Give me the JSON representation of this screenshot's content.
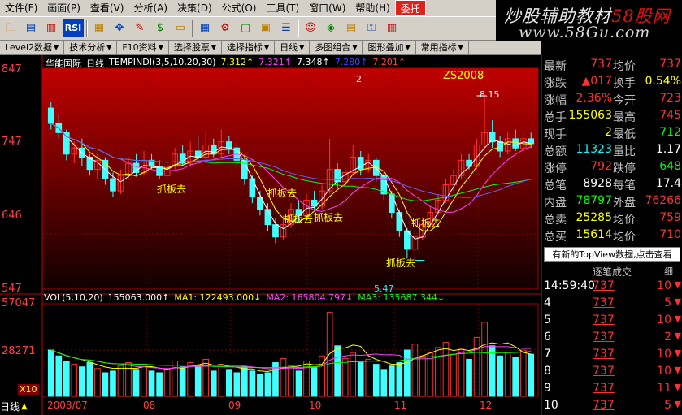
{
  "menu": [
    "文件(F)",
    "画面(P)",
    "查看(V)",
    "分析(A)",
    "决策(D)",
    "公式(O)",
    "工具(T)",
    "窗口(W)",
    "帮助(H)",
    "委托"
  ],
  "toolbar_icons": [
    "folder-icon",
    "chart-icon",
    "kline-icon",
    "rsi-button",
    "f10-icon",
    "move-icon",
    "pen-icon",
    "dollar-icon",
    "ruler-icon",
    "grid-icon",
    "tools-icon",
    "blank-icon",
    "save-icon",
    "list-icon",
    "person-icon",
    "map-icon",
    "news-icon",
    "lock-icon",
    "book-icon"
  ],
  "toolbar_rsi_label": "RSI",
  "brand": {
    "line1_a": "炒股辅助教材",
    "line1_b": "58股网",
    "line2": "www.58Gu.com"
  },
  "tabs": [
    "Level2数据",
    "技术分析",
    "F10资料",
    "选择股票",
    "选择指标",
    "日线",
    "多图组合",
    "图形叠加",
    "常用指标"
  ],
  "chart_header": {
    "stock_name": "华能国际",
    "period": "日线",
    "indicator": "TEMPINDI(3,5,10,20,30)",
    "values": [
      "7.312↑",
      "7.321↑",
      "7.348↑",
      "7.280↑",
      "7.201↑"
    ]
  },
  "vol_header": {
    "label": "VOL(5,10,20)",
    "items": [
      "155063.000↑",
      "MA1: 122493.000↓",
      "MA2: 165804.797↓",
      "MA3: 135687.344↓"
    ]
  },
  "y_axis_labels": [
    "847",
    "747",
    "646",
    "547"
  ],
  "vol_axis_labels": [
    "57047",
    "28271"
  ],
  "x10_label": "X10",
  "x_axis_labels": [
    "2008/07",
    "08",
    "09",
    "10",
    "11",
    "12"
  ],
  "day_button": "日线",
  "annotations": {
    "zs": "ZS2008",
    "high": "8.15",
    "low": "5.47",
    "marker_2": "2",
    "grab": [
      "抓板去",
      "抓板去",
      "抓板去",
      "抓板去",
      "抓板去",
      "抓板去"
    ]
  },
  "chart_data": {
    "type": "candlestick",
    "ylim": [
      5.0,
      8.6
    ],
    "candles": [
      {
        "o": 7.95,
        "c": 7.7,
        "h": 8.05,
        "l": 7.6
      },
      {
        "o": 7.7,
        "c": 7.55,
        "h": 7.85,
        "l": 7.45
      },
      {
        "o": 7.55,
        "c": 7.2,
        "h": 7.6,
        "l": 7.1
      },
      {
        "o": 7.2,
        "c": 7.3,
        "h": 7.4,
        "l": 7.05
      },
      {
        "o": 7.3,
        "c": 7.15,
        "h": 7.45,
        "l": 7.0
      },
      {
        "o": 7.15,
        "c": 6.95,
        "h": 7.2,
        "l": 6.85
      },
      {
        "o": 6.95,
        "c": 7.1,
        "h": 7.2,
        "l": 6.8
      },
      {
        "o": 7.1,
        "c": 6.8,
        "h": 7.15,
        "l": 6.7
      },
      {
        "o": 6.8,
        "c": 6.6,
        "h": 6.9,
        "l": 6.5
      },
      {
        "o": 6.6,
        "c": 6.85,
        "h": 6.95,
        "l": 6.55
      },
      {
        "o": 6.85,
        "c": 7.05,
        "h": 7.15,
        "l": 6.8
      },
      {
        "o": 7.05,
        "c": 6.9,
        "h": 7.2,
        "l": 6.85
      },
      {
        "o": 6.9,
        "c": 7.1,
        "h": 7.25,
        "l": 6.85
      },
      {
        "o": 7.1,
        "c": 7.0,
        "h": 7.2,
        "l": 6.95
      },
      {
        "o": 7.0,
        "c": 6.85,
        "h": 7.1,
        "l": 6.8
      },
      {
        "o": 6.85,
        "c": 7.0,
        "h": 7.1,
        "l": 6.75
      },
      {
        "o": 7.0,
        "c": 7.2,
        "h": 7.3,
        "l": 6.95
      },
      {
        "o": 7.2,
        "c": 7.05,
        "h": 7.35,
        "l": 7.0
      },
      {
        "o": 7.05,
        "c": 7.25,
        "h": 7.4,
        "l": 7.0
      },
      {
        "o": 7.25,
        "c": 7.15,
        "h": 7.5,
        "l": 7.1
      },
      {
        "o": 7.15,
        "c": 7.35,
        "h": 7.55,
        "l": 7.1
      },
      {
        "o": 7.35,
        "c": 7.2,
        "h": 7.45,
        "l": 7.15
      },
      {
        "o": 7.2,
        "c": 7.4,
        "h": 7.6,
        "l": 7.15
      },
      {
        "o": 7.4,
        "c": 7.3,
        "h": 7.5,
        "l": 7.2
      },
      {
        "o": 7.3,
        "c": 7.1,
        "h": 7.35,
        "l": 7.0
      },
      {
        "o": 7.1,
        "c": 6.8,
        "h": 7.15,
        "l": 6.7
      },
      {
        "o": 6.8,
        "c": 6.5,
        "h": 6.85,
        "l": 6.4
      },
      {
        "o": 6.5,
        "c": 6.3,
        "h": 6.6,
        "l": 6.2
      },
      {
        "o": 6.3,
        "c": 6.05,
        "h": 6.4,
        "l": 5.95
      },
      {
        "o": 6.05,
        "c": 5.85,
        "h": 6.15,
        "l": 5.75
      },
      {
        "o": 5.85,
        "c": 6.05,
        "h": 6.2,
        "l": 5.8
      },
      {
        "o": 6.05,
        "c": 6.3,
        "h": 6.4,
        "l": 6.0
      },
      {
        "o": 6.3,
        "c": 6.2,
        "h": 6.45,
        "l": 6.1
      },
      {
        "o": 6.2,
        "c": 6.45,
        "h": 6.55,
        "l": 6.15
      },
      {
        "o": 6.45,
        "c": 6.35,
        "h": 6.6,
        "l": 6.3
      },
      {
        "o": 6.35,
        "c": 6.6,
        "h": 6.7,
        "l": 6.3
      },
      {
        "o": 6.6,
        "c": 6.95,
        "h": 7.45,
        "l": 6.55
      },
      {
        "o": 6.95,
        "c": 6.75,
        "h": 7.05,
        "l": 6.65
      },
      {
        "o": 6.75,
        "c": 6.9,
        "h": 7.0,
        "l": 6.6
      },
      {
        "o": 6.9,
        "c": 7.15,
        "h": 7.35,
        "l": 6.85
      },
      {
        "o": 7.15,
        "c": 6.95,
        "h": 7.25,
        "l": 6.85
      },
      {
        "o": 6.95,
        "c": 7.1,
        "h": 7.2,
        "l": 6.9
      },
      {
        "o": 7.1,
        "c": 6.85,
        "h": 7.15,
        "l": 6.75
      },
      {
        "o": 6.85,
        "c": 6.55,
        "h": 6.9,
        "l": 6.45
      },
      {
        "o": 6.55,
        "c": 6.25,
        "h": 6.6,
        "l": 6.15
      },
      {
        "o": 6.25,
        "c": 5.95,
        "h": 6.3,
        "l": 5.85
      },
      {
        "o": 5.95,
        "c": 5.65,
        "h": 6.0,
        "l": 5.5
      },
      {
        "o": 5.65,
        "c": 5.85,
        "h": 5.95,
        "l": 5.47
      },
      {
        "o": 5.85,
        "c": 6.05,
        "h": 6.15,
        "l": 5.8
      },
      {
        "o": 6.05,
        "c": 6.25,
        "h": 6.35,
        "l": 6.0
      },
      {
        "o": 6.25,
        "c": 6.45,
        "h": 6.55,
        "l": 6.2
      },
      {
        "o": 6.45,
        "c": 6.7,
        "h": 6.8,
        "l": 6.4
      },
      {
        "o": 6.7,
        "c": 6.85,
        "h": 6.95,
        "l": 6.6
      },
      {
        "o": 6.85,
        "c": 7.1,
        "h": 7.2,
        "l": 6.8
      },
      {
        "o": 7.1,
        "c": 7.0,
        "h": 7.2,
        "l": 6.95
      },
      {
        "o": 7.0,
        "c": 7.35,
        "h": 7.45,
        "l": 6.95
      },
      {
        "o": 7.35,
        "c": 7.55,
        "h": 8.15,
        "l": 7.3
      },
      {
        "o": 7.55,
        "c": 7.4,
        "h": 7.75,
        "l": 7.3
      },
      {
        "o": 7.4,
        "c": 7.25,
        "h": 7.5,
        "l": 7.15
      },
      {
        "o": 7.25,
        "c": 7.45,
        "h": 7.55,
        "l": 7.2
      },
      {
        "o": 7.45,
        "c": 7.3,
        "h": 7.6,
        "l": 7.25
      },
      {
        "o": 7.3,
        "c": 7.45,
        "h": 7.55,
        "l": 7.25
      },
      {
        "o": 7.45,
        "c": 7.37,
        "h": 7.55,
        "l": 7.3
      }
    ],
    "volumes": [
      55,
      48,
      42,
      38,
      35,
      40,
      33,
      28,
      30,
      36,
      40,
      32,
      38,
      30,
      28,
      33,
      42,
      35,
      40,
      36,
      44,
      30,
      38,
      32,
      28,
      35,
      30,
      26,
      28,
      40,
      45,
      36,
      30,
      42,
      34,
      48,
      100,
      60,
      45,
      52,
      40,
      44,
      38,
      32,
      36,
      40,
      55,
      62,
      48,
      52,
      58,
      64,
      50,
      56,
      44,
      70,
      88,
      60,
      48,
      52,
      46,
      55,
      50
    ],
    "vol_ylim": [
      0,
      110
    ]
  },
  "quote": [
    {
      "l1": "最新",
      "v1": "737",
      "c1": "red",
      "l2": "均价",
      "v2": "737",
      "c2": "red"
    },
    {
      "l1": "涨跌",
      "v1": "▲017",
      "c1": "red",
      "l2": "换手",
      "v2": "0.54%",
      "c2": "yel"
    },
    {
      "l1": "涨幅",
      "v1": "2.36%",
      "c1": "red",
      "l2": "今开",
      "v2": "723",
      "c2": "red"
    },
    {
      "l1": "总手",
      "v1": "155063",
      "c1": "yel",
      "l2": "最高",
      "v2": "745",
      "c2": "red"
    },
    {
      "l1": "现手",
      "v1": "2",
      "c1": "yel",
      "l2": "最低",
      "v2": "712",
      "c2": "grn"
    },
    {
      "l1": "总额",
      "v1": "11323",
      "c1": "cyan",
      "l2": "量比",
      "v2": "1.17",
      "c2": "wht"
    },
    {
      "l1": "涨停",
      "v1": "792",
      "c1": "red",
      "l2": "跌停",
      "v2": "648",
      "c2": "grn"
    },
    {
      "l1": "总笔",
      "v1": "8928",
      "c1": "wht",
      "l2": "每笔",
      "v2": "17.4",
      "c2": "wht"
    },
    {
      "l1": "内盘",
      "v1": "78797",
      "c1": "grn",
      "l2": "外盘",
      "v2": "76266",
      "c2": "red"
    },
    {
      "l1": "总卖",
      "v1": "25285",
      "c1": "yel",
      "l2": "均价",
      "v2": "759",
      "c2": "red"
    },
    {
      "l1": "总买",
      "v1": "15614",
      "c1": "yel",
      "l2": "均价",
      "v2": "710",
      "c2": "red"
    }
  ],
  "topview_button": "有新的TopView数据,点击查看",
  "trades_header": {
    "title": "逐笔成交",
    "side": "细"
  },
  "trades": [
    {
      "time": "14:59:40",
      "price": "737",
      "vol": "10",
      "flag": "▼"
    },
    {
      "time": "4",
      "price": "737",
      "vol": "5",
      "flag": "▼"
    },
    {
      "time": "5",
      "price": "737",
      "vol": "10",
      "flag": "▼"
    },
    {
      "time": "6",
      "price": "737",
      "vol": "2",
      "flag": "▼"
    },
    {
      "time": "7",
      "price": "737",
      "vol": "10",
      "flag": "▼"
    },
    {
      "time": "8",
      "price": "737",
      "vol": "10",
      "flag": "▼"
    },
    {
      "time": "9",
      "price": "737",
      "vol": "11",
      "flag": "▼"
    },
    {
      "time": "10",
      "price": "737",
      "vol": "5",
      "flag": "▼"
    }
  ]
}
